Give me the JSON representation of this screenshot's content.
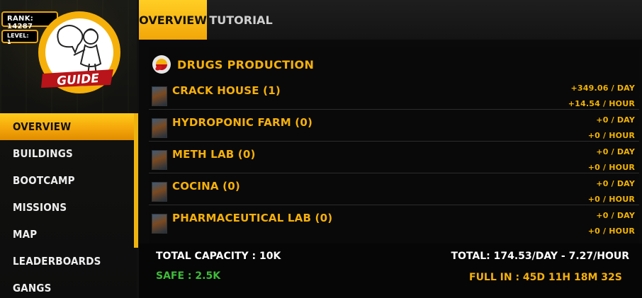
{
  "player": {
    "rank_label": "RANK: 14287",
    "level_label": "LEVEL: 1",
    "logo_text": "GUIDE"
  },
  "nav": {
    "items": [
      {
        "label": "OVERVIEW",
        "active": true
      },
      {
        "label": "BUILDINGS",
        "active": false
      },
      {
        "label": "BOOTCAMP",
        "active": false
      },
      {
        "label": "MISSIONS",
        "active": false
      },
      {
        "label": "MAP",
        "active": false
      },
      {
        "label": "LEADERBOARDS",
        "active": false
      },
      {
        "label": "GANGS",
        "active": false
      }
    ]
  },
  "tabs": [
    {
      "label": "OVERVIEW",
      "active": true
    },
    {
      "label": "TUTORIAL",
      "active": false
    }
  ],
  "section": {
    "title": "DRUGS PRODUCTION",
    "icon": "pills-icon"
  },
  "buildings": [
    {
      "name": "CRACK HOUSE (1)",
      "per_day": "+349.06 / DAY",
      "per_hour": "+14.54 / HOUR"
    },
    {
      "name": "HYDROPONIC FARM (0)",
      "per_day": "+0 / DAY",
      "per_hour": "+0 / HOUR"
    },
    {
      "name": "METH LAB (0)",
      "per_day": "+0 / DAY",
      "per_hour": "+0 / HOUR"
    },
    {
      "name": "COCINA (0)",
      "per_day": "+0 / DAY",
      "per_hour": "+0 / HOUR"
    },
    {
      "name": "PHARMACEUTICAL LAB (0)",
      "per_day": "+0 / DAY",
      "per_hour": "+0 / HOUR"
    }
  ],
  "footer": {
    "total_capacity": "TOTAL CAPACITY : 10K",
    "safe": "SAFE : 2.5K",
    "total_rate": "TOTAL: 174.53/DAY - 7.27/HOUR",
    "full_in": "FULL IN : 45D 11H 18M 32S"
  },
  "colors": {
    "accent": "#f5b00a",
    "safe_green": "#3fbb3a",
    "background": "#0a0a0a"
  }
}
